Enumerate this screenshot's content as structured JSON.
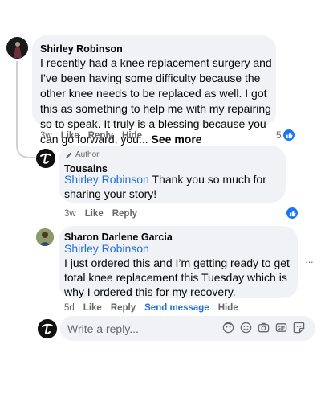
{
  "comment1": {
    "author": "Shirley Robinson",
    "text": "I recently had a knee replacement surgery and I’ve been having some difficulty because the other knee needs to be replaced as well. I got this as something to help me with my repairing so to speak. It truly is a blessing because you can go forward, you...",
    "see_more": "See more",
    "time": "3w",
    "like_label": "Like",
    "reply_label": "Reply",
    "hide_label": "Hide",
    "reaction_count": "5"
  },
  "reply1": {
    "badge": "Author",
    "author": "Tousains",
    "mention": "Shirley Robinson",
    "text": "Thank you so much for sharing your story!",
    "time": "3w",
    "like_label": "Like",
    "reply_label": "Reply"
  },
  "reply2": {
    "author": "Sharon Darlene Garcia",
    "mention": "Shirley Robinson",
    "text": "I just ordered this and I’m getting ready to get total knee replacement this Tuesday which is why I ordered this for my recovery.",
    "time": "5d",
    "like_label": "Like",
    "reply_label": "Reply",
    "send_message_label": "Send message",
    "hide_label": "Hide",
    "more_label": "···"
  },
  "composer": {
    "placeholder": "Write a reply..."
  },
  "colors": {
    "accent": "#216fdb",
    "bubble": "#f0f2f5",
    "muted": "#65676b"
  }
}
